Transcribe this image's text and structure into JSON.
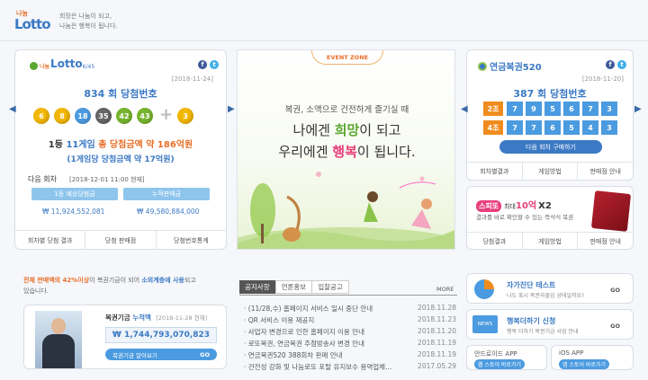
{
  "header": {
    "logo_small": "나눔",
    "logo_big": "Lotto",
    "slogan_1": "희망은 나눔이 되고,",
    "slogan_2": "나눔은 행복이 됩니다."
  },
  "lotto645": {
    "logo_small": "나눔",
    "logo_text": "Lotto",
    "logo_sub": "6/45",
    "date": "[2018-11-24]",
    "draw_title": "834 회 당첨번호",
    "numbers": [
      "6",
      "8",
      "18",
      "35",
      "42",
      "43"
    ],
    "bonus": "3",
    "plus": "+",
    "prize_line1_prefix": "1등 ",
    "prize_line1_games": "11게임",
    "prize_line1_mid": " 총 당첨금액 약 ",
    "prize_line1_amount": "186억원",
    "prize_line2": "(1게임당 당첨금액 약 17억원)",
    "next_label": "다음 회차",
    "next_date": "[2018-12-01 11:00 현재]",
    "est_label": "1등 예상당첨금",
    "est_value": "₩ 11,924,552,081",
    "sales_label": "누적판매금",
    "sales_value": "₩ 49,580,884,000",
    "links": [
      "회차별 당첨 결과",
      "당첨 판매점",
      "당첨번호통계"
    ]
  },
  "event": {
    "tag": "EVENT ZONE",
    "line1": "복권, 소액으로 건전하게 즐기실 때",
    "line2_a": "나에겐 ",
    "line2_b": "희망",
    "line2_c": "이 되고",
    "line3_a": "우리에겐 ",
    "line3_b": "행복",
    "line3_c": "이 됩니다."
  },
  "pension": {
    "logo": "연금복권520",
    "date": "[2018-11-20]",
    "draw_title": "387 회 당첨번호",
    "rows": [
      {
        "group": "2조",
        "digits": [
          "7",
          "9",
          "5",
          "6",
          "7",
          "3"
        ]
      },
      {
        "group": "4조",
        "digits": [
          "7",
          "7",
          "6",
          "5",
          "4",
          "3"
        ]
      }
    ],
    "buy_button": "다음 회차 구매하기",
    "links": [
      "회차별결과",
      "게임방법",
      "판매점 안내"
    ]
  },
  "speetto": {
    "logo": "스피또",
    "title_mid": "최대 ",
    "title_amount": "10억",
    "title_mult": "X2",
    "desc1": "결과를 바로 확인할 수 있는 즉석식 복권",
    "links": [
      "당첨결과",
      "게임방법",
      "판매점 안내"
    ]
  },
  "fund": {
    "text1_a": "전체 판매액의 42%이상",
    "text1_b": "이 복권기금이 되어 ",
    "text1_c": "소외계층에 사용",
    "text1_d": "되고",
    "text2": "있습니다.",
    "accum_label_a": "복권기금 ",
    "accum_label_b": "누적액",
    "accum_date": "[2018-11-28 현재]",
    "accum_value": "₩ 1,744,793,070,823",
    "more_button": "복권기금 알아보기",
    "go": "GO"
  },
  "notice": {
    "tabs": [
      "공지사항",
      "언론홍보",
      "입찰공고"
    ],
    "more": "MORE",
    "items": [
      {
        "title": "· (11/28,수) 홈페이지 서비스 일시 중단 안내",
        "date": "2018.11.28"
      },
      {
        "title": "· QR 서비스 이용 재공지",
        "date": "2018.11.23"
      },
      {
        "title": "· 사업자 변경으로 인한 홈페이지 이용 안내",
        "date": "2018.11.20"
      },
      {
        "title": "· 로또복권, 연금복권 추첨방송사 변경 안내",
        "date": "2018.11.19"
      },
      {
        "title": "· 연금복권520 388회차 판매 안내",
        "date": "2018.11.19"
      },
      {
        "title": "· 건전성 강화 및 나눔로또 포탈 유지보수 용역업체...",
        "date": "2017.05.29"
      }
    ]
  },
  "side": {
    "test_title": "자가진단 테스트",
    "test_desc": "나도 혹시 복권과몰입 상태일까요?",
    "test_go": "GO",
    "happy_title": "행복더하기 신청",
    "happy_desc": "행복 더하기 복권기금 사업 안내",
    "happy_go": "GO",
    "android_title": "안드로이드 APP",
    "android_link": "웹 스토어 바로가기",
    "ios_title": "iOS APP",
    "ios_link": "앱 스토어 바로가기",
    "news_badge": "NEWS"
  },
  "colors": {
    "blue": "#3b6aa8",
    "orange": "#f08c1e",
    "green": "#5aa62e",
    "pink": "#e83e7b",
    "sky": "#4b9be0"
  }
}
